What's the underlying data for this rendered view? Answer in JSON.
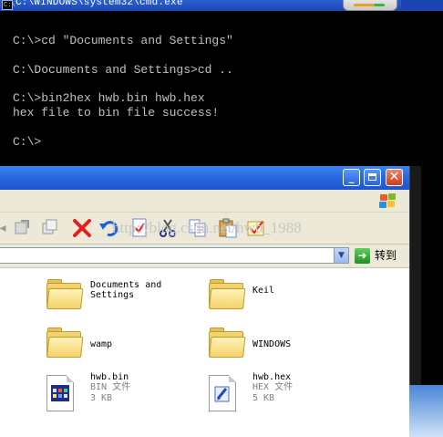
{
  "cmd": {
    "title": "C:\\WINDOWS\\system32\\cmd.exe",
    "icon_text": "C:\\",
    "lines": [
      "C:\\>cd \"Documents and Settings\"",
      "C:\\Documents and Settings>cd ..",
      "C:\\>bin2hex hwb.bin hwb.hex",
      "hex file to bin file success!",
      "C:\\>"
    ]
  },
  "explorer": {
    "title_buttons": {
      "minimize": "_",
      "close": "✕"
    },
    "toolbar": {
      "icons": [
        "move-to-icon",
        "copy-to-icon",
        "delete-icon",
        "undo-icon",
        "properties-icon",
        "cut-icon",
        "copy-icon",
        "paste-icon",
        "check-icon"
      ]
    },
    "watermark": "http://blog.csdn.net/hwb_1988",
    "address": {
      "go_label": "转到",
      "value": ""
    },
    "items": [
      {
        "name": "Documents and\nSettings",
        "type": "folder"
      },
      {
        "name": "Keil",
        "type": "folder"
      },
      {
        "name": "wamp",
        "type": "folder"
      },
      {
        "name": "WINDOWS",
        "type": "folder"
      },
      {
        "name": "hwb.bin",
        "filetype": "BIN 文件",
        "size": "3 KB",
        "icon": "bin-file-icon"
      },
      {
        "name": "hwb.hex",
        "filetype": "HEX 文件",
        "size": "5 KB",
        "icon": "hex-file-icon"
      }
    ]
  },
  "colors": {
    "cmd_text": "#c0c0c0",
    "xp_blue": "#2a6ae0",
    "xp_close": "#c8401c",
    "toolbar_bg": "#ece9d8"
  }
}
